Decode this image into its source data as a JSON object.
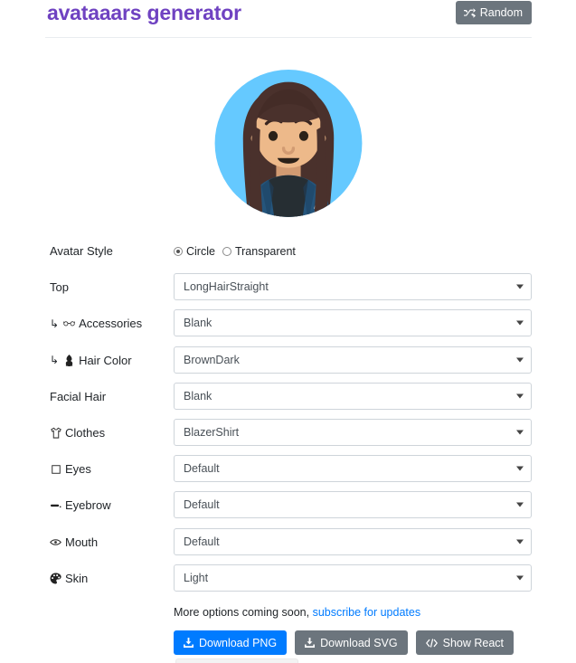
{
  "header": {
    "title": "avataaars generator",
    "random_label": "Random",
    "random_icon": "shuffle-icon"
  },
  "avatar": {
    "style": "Circle",
    "background_color": "#65C9FF",
    "skin_color": "#EDB98A",
    "hair_color": "#4A312C",
    "clothes_color": "#25557C",
    "shirt_color": "#262E33",
    "top": "LongHairStraight",
    "facial_hair": "Blank",
    "accessories": "Blank",
    "eyes": "Default",
    "eyebrow": "Default",
    "mouth": "Default"
  },
  "form": {
    "avatar_style": {
      "label": "Avatar Style",
      "options": [
        "Circle",
        "Transparent"
      ],
      "selected": "Circle"
    },
    "rows": [
      {
        "label": "Top",
        "icon": "",
        "sub": false,
        "value": "LongHairStraight"
      },
      {
        "label": "Accessories",
        "icon": "glasses-icon",
        "sub": true,
        "value": "Blank"
      },
      {
        "label": "Hair Color",
        "icon": "hair-color-icon",
        "sub": true,
        "value": "BrownDark"
      },
      {
        "label": "Facial Hair",
        "icon": "",
        "sub": false,
        "value": "Blank"
      },
      {
        "label": "Clothes",
        "icon": "tshirt-icon",
        "sub": false,
        "value": "BlazerShirt"
      },
      {
        "label": "Eyes",
        "icon": "eye-box-icon",
        "sub": false,
        "value": "Default"
      },
      {
        "label": "Eyebrow",
        "icon": "eyebrow-icon",
        "sub": false,
        "value": "Default"
      },
      {
        "label": "Mouth",
        "icon": "mouth-icon",
        "sub": false,
        "value": "Default"
      },
      {
        "label": "Skin",
        "icon": "palette-icon",
        "sub": false,
        "value": "Light"
      }
    ]
  },
  "footer": {
    "note_text": "More options coming soon, ",
    "note_link": "subscribe for updates",
    "buttons": [
      {
        "label": "Download PNG",
        "icon": "download-icon",
        "style": "primary"
      },
      {
        "label": "Download SVG",
        "icon": "download-icon",
        "style": "secondary"
      },
      {
        "label": "Show React",
        "icon": "code-icon",
        "style": "secondary"
      }
    ]
  },
  "colors": {
    "title": "#6f42c1",
    "primary": "#007bff",
    "secondary": "#6c757d",
    "link": "#007bff"
  }
}
